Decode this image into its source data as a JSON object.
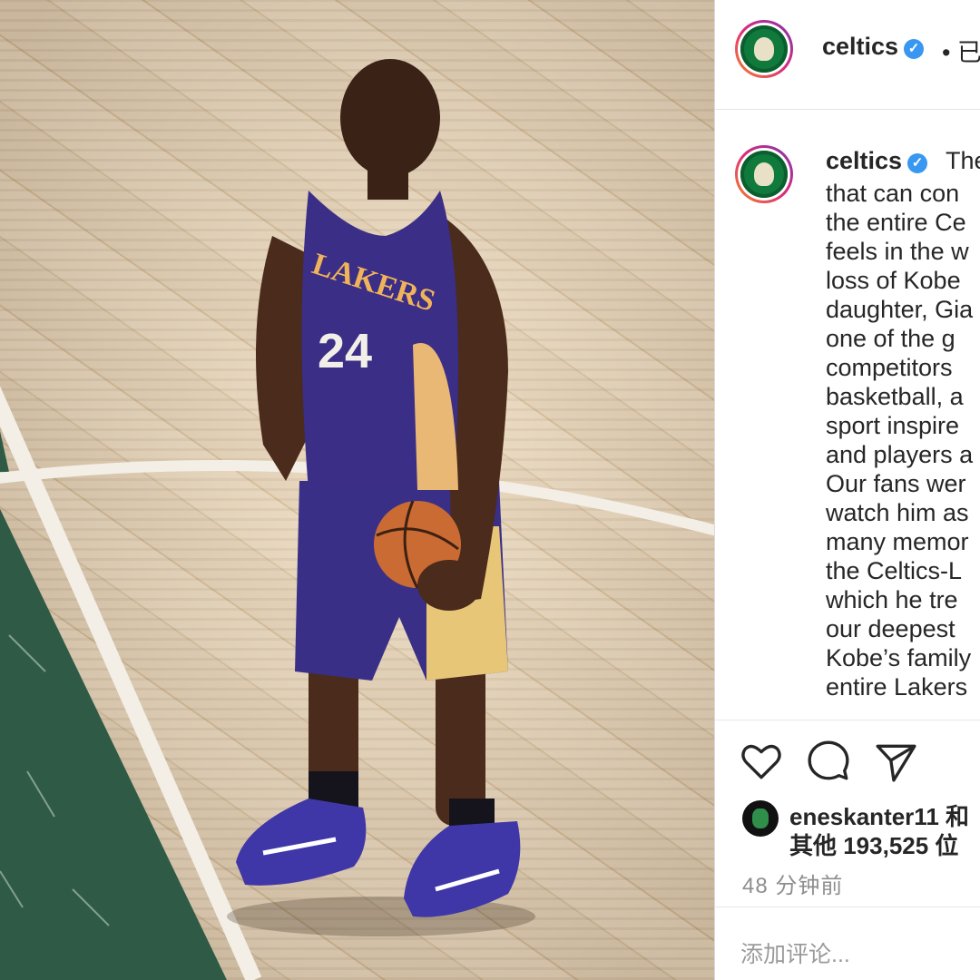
{
  "post": {
    "username": "celtics",
    "verified_glyph": "✓",
    "follow_suffix": "• 已",
    "caption_user": "celtics",
    "caption_first": "The",
    "caption_lines": [
      "that can con",
      "the entire Ce",
      "feels in the w",
      "loss of Kobe",
      "daughter, Gia",
      "one of the g",
      "competitors",
      "basketball, a",
      "sport inspire",
      "and players a",
      "Our fans wer",
      "watch him as",
      "many memor",
      "the Celtics-L",
      "which he tre",
      "our deepest",
      "Kobe’s family",
      "entire Lakers"
    ],
    "likes_user": "eneskanter11 和",
    "likes_count": "其他 193,525 位",
    "time_ago": "48 分钟前",
    "comment_placeholder": "添加评论..."
  },
  "photo": {
    "jersey_text": "LAKERS",
    "jersey_number": "24"
  },
  "icons": [
    "heart-icon",
    "comment-icon",
    "share-icon",
    "verified-badge-icon"
  ],
  "colors": {
    "jersey_purple": "#3b2e86",
    "court_green": "#2e5a45",
    "verified_blue": "#3897f0"
  }
}
